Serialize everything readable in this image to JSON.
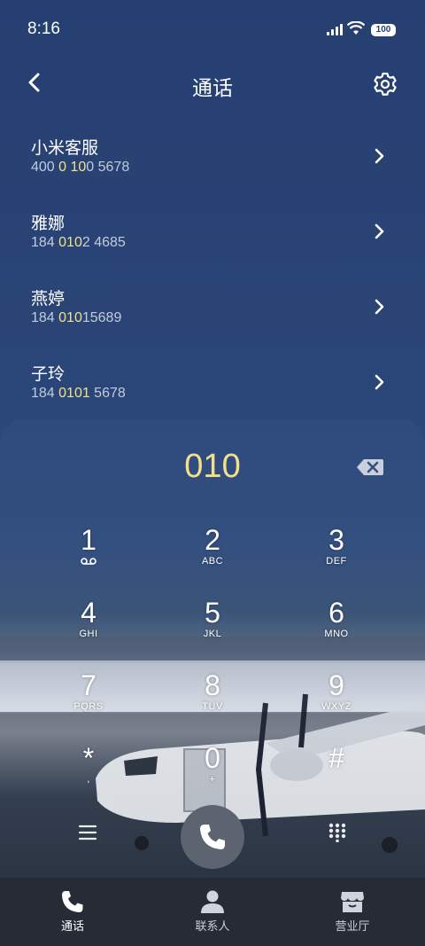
{
  "status": {
    "time": "8:16",
    "battery": "100"
  },
  "header": {
    "title": "通话"
  },
  "contacts": [
    {
      "name": "小米客服",
      "num_pre": "400 ",
      "num_hl": "0 10",
      "num_post": "0 5678"
    },
    {
      "name": "雅娜",
      "num_pre": "184 ",
      "num_hl": "010",
      "num_post": "2 4685"
    },
    {
      "name": "燕婷",
      "num_pre": "184 ",
      "num_hl": "010",
      "num_post": "15689"
    },
    {
      "name": "子玲",
      "num_pre": "184 ",
      "num_hl": "0101",
      "num_post": " 5678"
    }
  ],
  "dialer": {
    "entered": "010",
    "keys": [
      {
        "n": "1",
        "l": "voicemail-icon"
      },
      {
        "n": "2",
        "l": "ABC"
      },
      {
        "n": "3",
        "l": "DEF"
      },
      {
        "n": "4",
        "l": "GHI"
      },
      {
        "n": "5",
        "l": "JKL"
      },
      {
        "n": "6",
        "l": "MNO"
      },
      {
        "n": "7",
        "l": "PQRS"
      },
      {
        "n": "8",
        "l": "TUV"
      },
      {
        "n": "9",
        "l": "WXYZ"
      },
      {
        "n": "*",
        "l": ","
      },
      {
        "n": "0",
        "l": "+"
      },
      {
        "n": "#",
        "l": ""
      }
    ]
  },
  "nav": {
    "calls": "通话",
    "contacts": "联系人",
    "store": "营业厅"
  },
  "colors": {
    "highlight": "#f1e28a",
    "background": "#263f72",
    "nav": "#262b36"
  }
}
